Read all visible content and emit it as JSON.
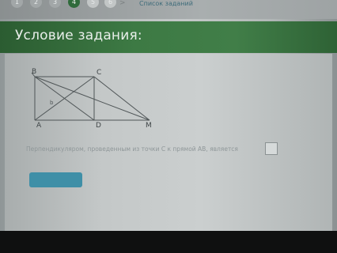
{
  "steps": [
    {
      "label": "1",
      "state": "done"
    },
    {
      "label": "2",
      "state": "done"
    },
    {
      "label": "3",
      "state": "done"
    },
    {
      "label": "4",
      "state": "current"
    },
    {
      "label": "5",
      "state": "inactive"
    },
    {
      "label": "6",
      "state": "inactive"
    }
  ],
  "nav": {
    "next_arrow": ">",
    "tasks_link": "Список заданий"
  },
  "header": {
    "title": "Условие задания:"
  },
  "figure": {
    "labels": {
      "B": "B",
      "C": "C",
      "A": "A",
      "D": "D",
      "M": "M",
      "b": "b"
    }
  },
  "problem": {
    "text": "Перпендикуляром, проведенным из точки C к прямой AB, является"
  },
  "colors": {
    "header": "#3d7a44",
    "button": "#3f8fa7"
  }
}
